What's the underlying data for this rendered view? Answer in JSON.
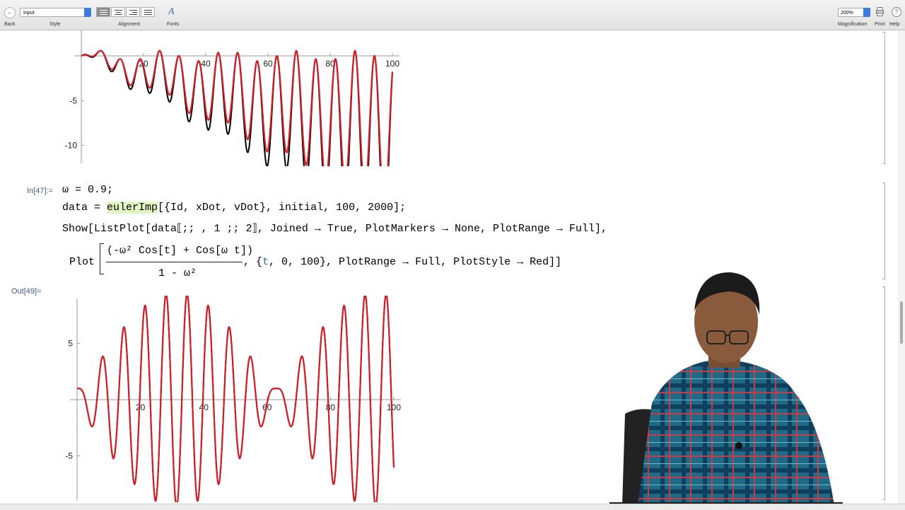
{
  "toolbar": {
    "back_icon": "←",
    "back_label": "Back",
    "style_value": "Input",
    "style_label": "Style",
    "alignment_label": "Alignment",
    "fonts_icon": "A",
    "fonts_label": "Fonts",
    "magnification_value": "200%",
    "magnification_label": "Magnification",
    "print_label": "Print",
    "help_icon": "?",
    "help_label": "Help"
  },
  "cell": {
    "in_label": "In[47]:=",
    "line1": "ω = 0.9;",
    "line2_a": "data = ",
    "line2_hl": "eulerImp",
    "line2_b": "[{Id, xDot, vDot}, initial, 100, 2000];",
    "line3": "Show[ListPlot[data⟦;; , 1 ;; 2⟧, Joined → True, PlotMarkers → None, PlotRange → Full],",
    "line4_head": "Plot",
    "numerator": "(-ω² Cos[t] + Cos[ω t])",
    "denominator": "1 - ω²",
    "line4_tail_a": ", {",
    "line4_t": "t",
    "line4_tail_b": ", 0, 100}, PlotRange → Full, PlotStyle → Red]]",
    "out_label": "Out[49]="
  },
  "chart_data": [
    {
      "type": "line",
      "title": "",
      "xlabel": "",
      "ylabel": "",
      "x_ticks": [
        "20",
        "40",
        "60",
        "80",
        "100"
      ],
      "y_ticks": [
        "-5",
        "-10"
      ],
      "xlim": [
        0,
        100
      ],
      "ylim": [
        -12,
        3
      ],
      "series": [
        {
          "color": "#000000",
          "formula": "euler",
          "omega": 1
        },
        {
          "color": "#d0202a",
          "formula": "exact",
          "omega": 1
        }
      ]
    },
    {
      "type": "line",
      "title": "",
      "xlabel": "",
      "ylabel": "",
      "x_ticks": [
        "20",
        "40",
        "60",
        "80",
        "100"
      ],
      "y_ticks": [
        "5",
        "-5"
      ],
      "xlim": [
        0,
        100
      ],
      "ylim": [
        -9,
        9
      ],
      "series": [
        {
          "color": "#000000",
          "formula": "exact",
          "omega": 0.9
        },
        {
          "color": "#d0202a",
          "formula": "exact",
          "omega": 0.9
        }
      ]
    }
  ]
}
